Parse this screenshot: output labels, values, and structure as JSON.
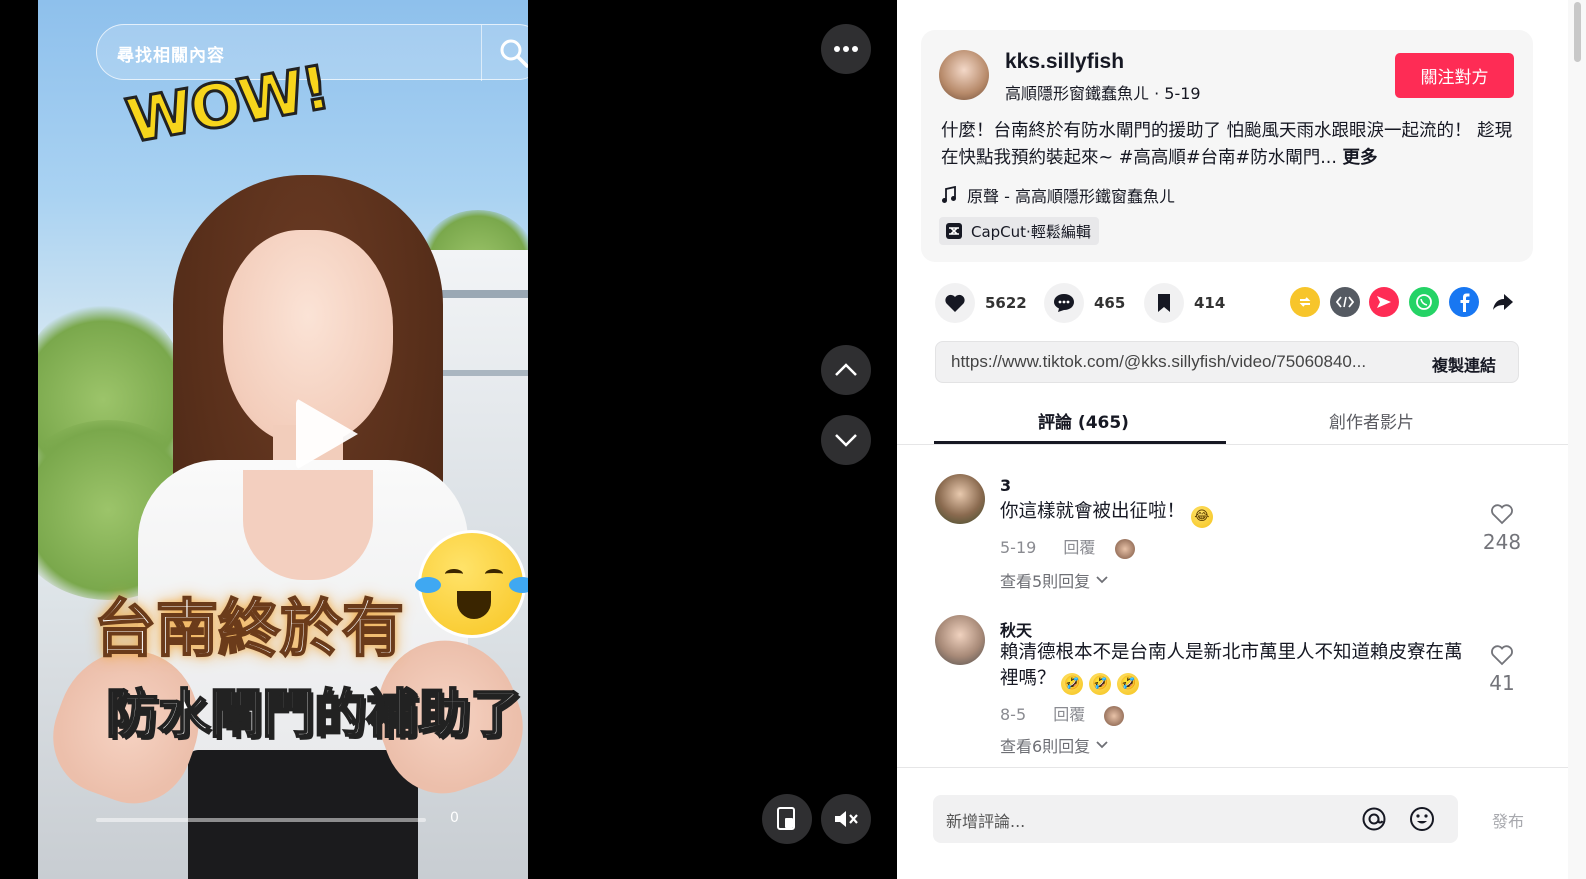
{
  "player": {
    "search_placeholder": "尋找相關內容",
    "overlay_wow": "WOW!",
    "caption_line1": "台南終於有",
    "caption_line2": "防水閘門的補助了",
    "time": "0"
  },
  "author": {
    "name": "kks.sillyfish",
    "nickname": "高順隱形窗鐵蠢魚ㄦ",
    "separator": " · ",
    "date": "5-19",
    "follow_label": "關注對方"
  },
  "post": {
    "description": "什麼！台南終於有防水閘門的援助了 怕颱風天雨水跟眼淚一起流的！ 趁現在快點我預約裝起來~ #高高順#台南#防水閘門...",
    "more_label": "更多",
    "music": "原聲 - 高高順隱形鐵窗蠢魚ㄦ",
    "capcut": "CapCut·輕鬆編輯"
  },
  "stats": {
    "likes": "5622",
    "comments": "465",
    "saves": "414"
  },
  "share": {
    "url": "https://www.tiktok.com/@kks.sillyfish/video/75060840...",
    "copy_label": "複製連結"
  },
  "tabs": [
    {
      "label": "評論 (465)",
      "active": true
    },
    {
      "label": "創作者影片",
      "active": false
    }
  ],
  "comments": [
    {
      "author": "3",
      "text": "你這樣就會被出征啦！",
      "date": "5-19",
      "reply_label": "回覆",
      "likes": "248",
      "view_replies": "查看5則回复"
    },
    {
      "author": "秋天",
      "text": "賴清德根本不是台南人是新北市萬里人不知道賴皮寮在萬裡嗎？",
      "date": "8-5",
      "reply_label": "回覆",
      "likes": "41",
      "view_replies": "查看6則回复"
    }
  ],
  "composer": {
    "placeholder": "新增評論...",
    "post_label": "發布"
  },
  "colors": {
    "accent": "#fe2c55",
    "text": "#161823",
    "muted": "#8a8b91"
  }
}
